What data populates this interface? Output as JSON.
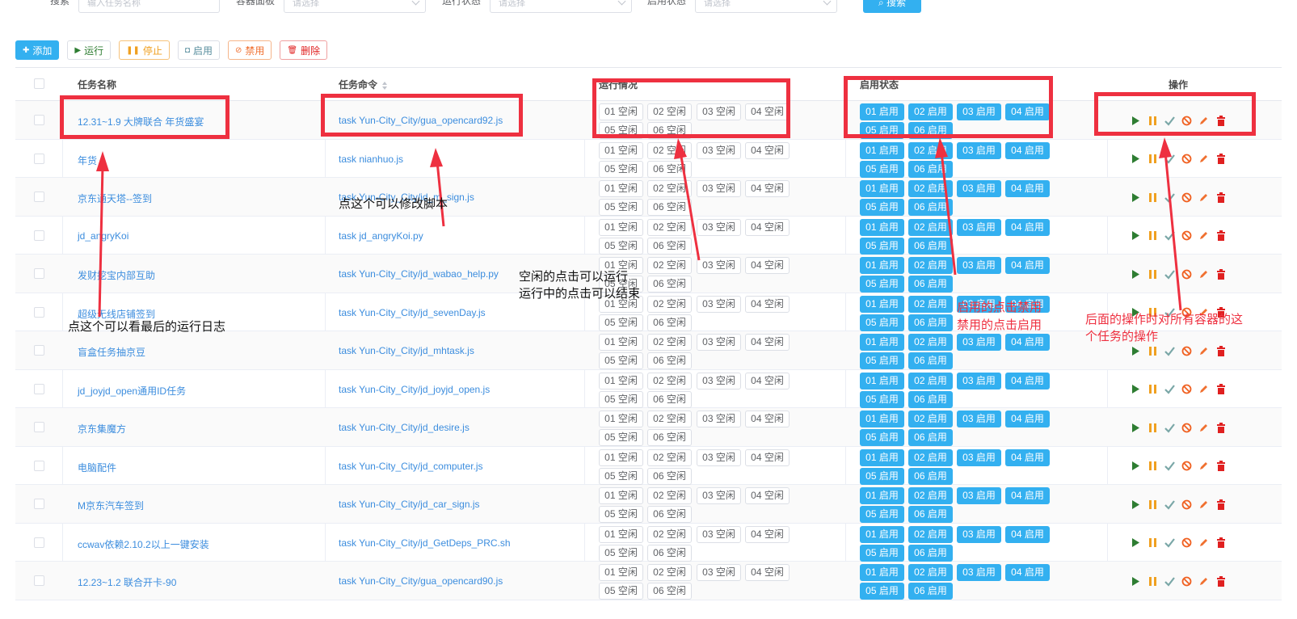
{
  "filters": [
    {
      "label": "搜索",
      "placeholder": "输入任务名称"
    },
    {
      "label": "容器面板",
      "placeholder": "请选择"
    },
    {
      "label": "运行状态",
      "placeholder": "请选择"
    },
    {
      "label": "启用状态",
      "placeholder": "请选择"
    }
  ],
  "search_button": "搜索",
  "toolbar": {
    "add": "添加",
    "run": "运行",
    "stop": "停止",
    "enable": "启用",
    "disable": "禁用",
    "delete": "删除"
  },
  "table": {
    "headers": {
      "name": "任务名称",
      "command": "任务命令",
      "run_status": "运行情况",
      "enable_status": "启用状态",
      "actions": "操作"
    },
    "rows": [
      {
        "name": "12.31~1.9 大牌联合 年货盛宴",
        "command": "task Yun-City_City/gua_opencard92.js"
      },
      {
        "name": "年货",
        "command": "task nianhuo.js"
      },
      {
        "name": "京东通天塔--签到",
        "command": "task Yun-City_City/jd_m_sign.js"
      },
      {
        "name": "jd_angryKoi",
        "command": "task jd_angryKoi.py"
      },
      {
        "name": "发财挖宝内部互助",
        "command": "task Yun-City_City/jd_wabao_help.py"
      },
      {
        "name": "超级无线店铺签到",
        "command": "task Yun-City_City/jd_sevenDay.js"
      },
      {
        "name": "盲盒任务抽京豆",
        "command": "task Yun-City_City/jd_mhtask.js"
      },
      {
        "name": "jd_joyjd_open通用ID任务",
        "command": "task Yun-City_City/jd_joyjd_open.js"
      },
      {
        "name": "京东集魔方",
        "command": "task Yun-City_City/jd_desire.js"
      },
      {
        "name": "电脑配件",
        "command": "task Yun-City_City/jd_computer.js"
      },
      {
        "name": "M京东汽车签到",
        "command": "task Yun-City_City/jd_car_sign.js"
      },
      {
        "name": "ccwav依赖2.10.2以上一键安装",
        "command": "task Yun-City_City/jd_GetDeps_PRC.sh"
      },
      {
        "name": "12.23~1.2 联合开卡-90",
        "command": "task Yun-City_City/gua_opencard90.js"
      }
    ],
    "run_pills": [
      "01 空闲",
      "02 空闲",
      "03 空闲",
      "04 空闲",
      "05 空闲",
      "06 空闲"
    ],
    "enable_pills": [
      "01 启用",
      "02 启用",
      "03 启用",
      "04 启用",
      "05 启用",
      "06 启用"
    ]
  },
  "annotations": {
    "log": "点这个可以看最后的运行日志",
    "script": "点这个可以修改脚本",
    "run_line1": "空闲的点击可以运行",
    "run_line2": "运行中的点击可以结束",
    "enable_line1": "启用的点击禁用",
    "enable_line2": "禁用的点击启用",
    "ops_line1": "后面的操作时对所有容器的这",
    "ops_line2": "个任务的操作"
  },
  "colors": {
    "accent": "#33b0f0",
    "link": "#3c8dde",
    "annotation": "#ee3040"
  }
}
